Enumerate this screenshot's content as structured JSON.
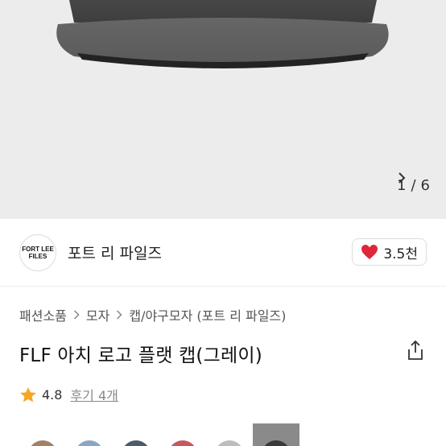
{
  "gallery": {
    "current": "1",
    "total": "6",
    "separator": "/"
  },
  "shop": {
    "logo_text_line1": "FORT LEE",
    "logo_text_line2": "FILES",
    "name": "포트 리 파일즈",
    "likes": "3.5천"
  },
  "breadcrumb": {
    "items": [
      "패션소품",
      "모자",
      "캡/야구모자 (포트 리 파일즈)"
    ]
  },
  "product": {
    "title": "FLF 아치 로고 플랫 캡(그레이)"
  },
  "rating": {
    "score": "4.8",
    "reviews_label": "후기 4개"
  },
  "thumbnails": {
    "colors": [
      "#a48066",
      "#8aa6c4",
      "#4e5a6c",
      "#c45a5e",
      "#bdbdbd",
      "#3a3a3a"
    ],
    "selected_index": 5
  },
  "colors": {
    "like_heart": "#e0263a",
    "star": "#f5a623",
    "hero_bg": "#ececec",
    "cap_gray": "#5e5e5e"
  },
  "icons": {
    "like": "heart-icon",
    "star": "star-icon",
    "share": "share-icon",
    "next": "chevron-right-icon",
    "breadcrumb_sep": "chevron-right-icon"
  }
}
